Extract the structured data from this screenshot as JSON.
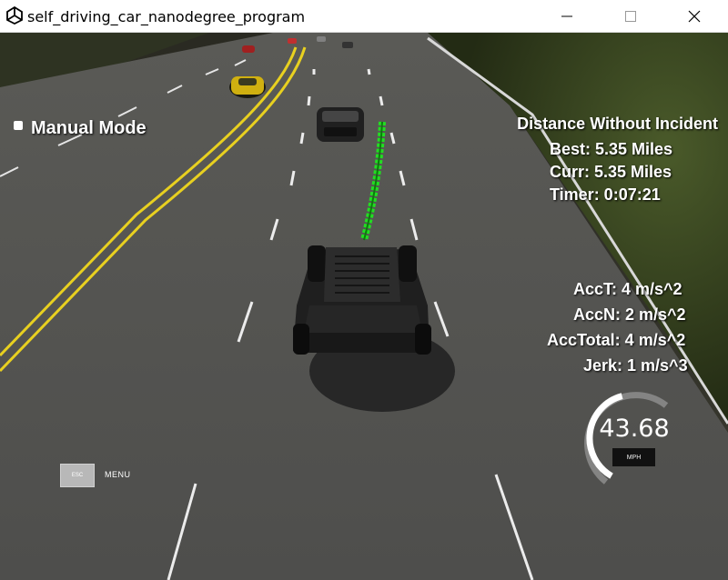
{
  "window": {
    "title": "self_driving_car_nanodegree_program",
    "icon": "unity-icon",
    "controls": [
      "minimize-icon",
      "maximize-icon",
      "close-icon"
    ]
  },
  "hud": {
    "mode_label": "Manual Mode",
    "distance_heading": "Distance Without Incident",
    "best": "Best: 5.35 Miles",
    "current": "Curr: 5.35 Miles",
    "timer": "Timer: 0:07:21",
    "acc_t": "AccT: 4 m/s^2",
    "acc_n": "AccN: 2 m/s^2",
    "acc_total": "AccTotal: 4 m/s^2",
    "jerk": "Jerk: 1 m/s^3"
  },
  "menu": {
    "key_label": "ESC",
    "label": "MENU"
  },
  "speedometer": {
    "value": "43.68",
    "unit": "MPH",
    "fill_fraction": 0.6
  },
  "colors": {
    "path": "#22dd22",
    "center_line": "#e8d020",
    "road": "#505050",
    "grass": "#2c3a1a"
  }
}
